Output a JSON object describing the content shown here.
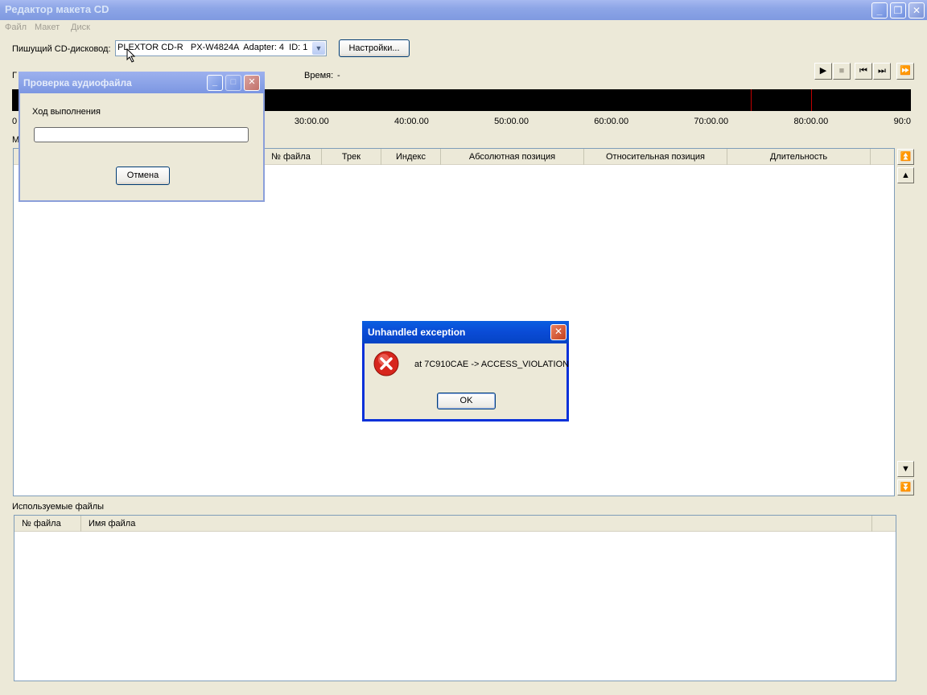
{
  "window": {
    "title": "Редактор макета CD"
  },
  "menu": [
    "Файл",
    "Макет",
    "Диск"
  ],
  "drive": {
    "label": "Пишущий CD-дисковод:",
    "value": "PLEXTOR CD-R   PX-W4824A  Adapter: 4  ID: 1",
    "settings_label": "Настройки..."
  },
  "time": {
    "label": "Время:",
    "value": "-"
  },
  "partial_labels": {
    "left_label_1": "Г",
    "left_label_2": "М"
  },
  "timeline": {
    "ticks": [
      "0",
      "30:00.00",
      "40:00.00",
      "50:00.00",
      "60:00.00",
      "70:00.00",
      "80:00.00",
      "90:0"
    ],
    "marker_times_min": [
      74,
      80
    ]
  },
  "tracks_table": {
    "columns": [
      "№ файла",
      "Трек",
      "Индекс",
      "Абсолютная позиция",
      "Относительная позиция",
      "Длительность"
    ]
  },
  "files_section": {
    "label": "Используемые файлы",
    "columns": [
      "№ файла",
      "Имя файла"
    ]
  },
  "progress_dialog": {
    "title": "Проверка аудиофайла",
    "label": "Ход выполнения",
    "cancel_label": "Отмена",
    "progress": 0
  },
  "error_dialog": {
    "title": "Unhandled exception",
    "message": "at 7C910CAE -> ACCESS_VIOLATION",
    "ok_label": "OK"
  },
  "colors": {
    "error_title": "#0a4bd6",
    "timeline_bg": "#000000",
    "marker": "#c00000"
  },
  "icons": {
    "play": "play-icon",
    "stop": "stop-icon",
    "prev": "skip-back-icon",
    "next": "skip-forward-icon",
    "fast_forward": "fast-forward-icon",
    "error": "error-icon"
  }
}
